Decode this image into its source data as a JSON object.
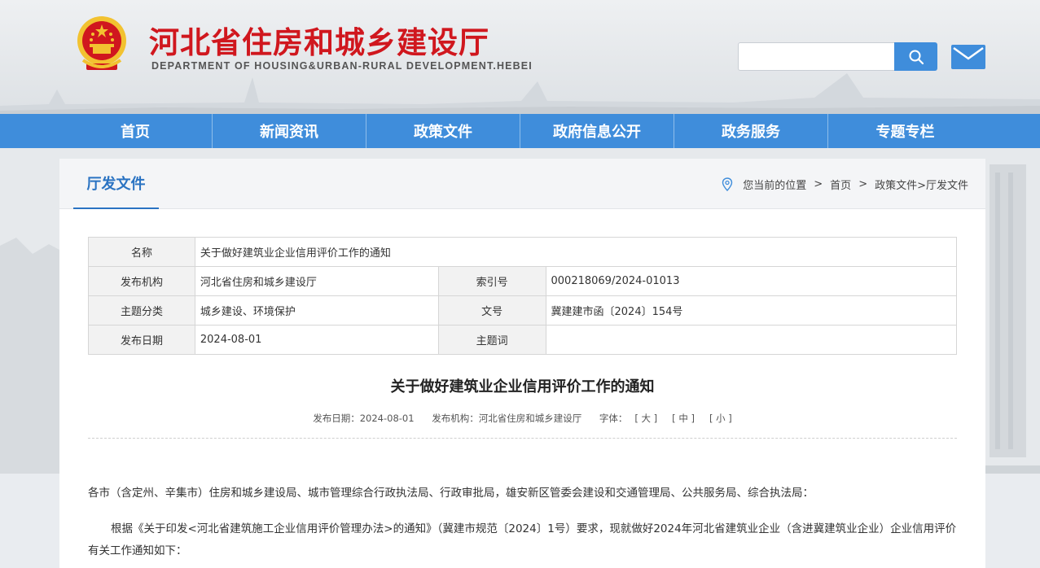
{
  "header": {
    "site_title": "河北省住房和城乡建设厅",
    "site_subtitle": "DEPARTMENT OF HOUSING&URBAN-RURAL DEVELOPMENT.HEBEI",
    "search_placeholder": "",
    "accent_color": "#3f8ddb",
    "title_color": "#d0171e"
  },
  "nav": {
    "items": [
      "首页",
      "新闻资讯",
      "政策文件",
      "政府信息公开",
      "政务服务",
      "专题专栏"
    ]
  },
  "panel": {
    "section_title": "厅发文件",
    "breadcrumb": {
      "prefix": "您当前的位置",
      "home": "首页",
      "sep": ">",
      "path": "政策文件>厅发文件"
    }
  },
  "info_table": {
    "name_label": "名称",
    "name_value": "关于做好建筑业企业信用评价工作的通知",
    "issuer_label": "发布机构",
    "issuer_value": "河北省住房和城乡建设厅",
    "index_label": "索引号",
    "index_value": "000218069/2024-01013",
    "topic_label": "主题分类",
    "topic_value": "城乡建设、环境保护",
    "docno_label": "文号",
    "docno_value": "冀建建市函〔2024〕154号",
    "date_label": "发布日期",
    "date_value": "2024-08-01",
    "keyword_label": "主题词",
    "keyword_value": ""
  },
  "article": {
    "title": "关于做好建筑业企业信用评价工作的通知",
    "meta_date": "发布日期：2024-08-01",
    "meta_issuer": "发布机构：河北省住房和城乡建设厅",
    "font_label": "字体：",
    "font_large": "[ 大 ]",
    "font_medium": "[ 中 ]",
    "font_small": "[ 小 ]",
    "para1": "各市（含定州、辛集市）住房和城乡建设局、城市管理综合行政执法局、行政审批局，雄安新区管委会建设和交通管理局、公共服务局、综合执法局：",
    "para2": "根据《关于印发<河北省建筑施工企业信用评价管理办法>的通知》（冀建市规范〔2024〕1号）要求，现就做好2024年河北省建筑业企业（含进冀建筑业企业）企业信用评价有关工作通知如下："
  }
}
